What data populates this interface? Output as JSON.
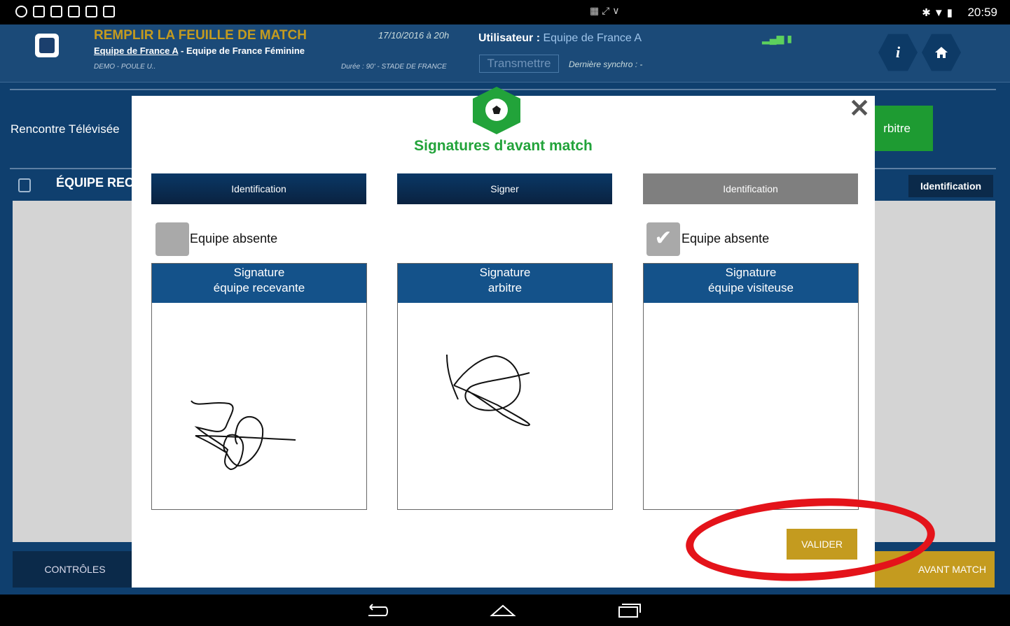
{
  "status_bar": {
    "time": "20:59",
    "left_icons": [
      "eye-icon",
      "messenger-icon",
      "gmail-icon",
      "play-store-icon",
      "shopping-bag-icon",
      "shopping-bag-icon"
    ],
    "right_icons": [
      "bluetooth-icon",
      "wifi-icon",
      "battery-icon"
    ]
  },
  "header": {
    "title": "REMPLIR LA FEUILLE DE MATCH",
    "home_team": "Equipe de France A",
    "teams_separator": " - ",
    "away_team": "Equipe de France Féminine",
    "competition": "DEMO - POULE U..",
    "date": "17/10/2016 à 20h",
    "duration": "Durée : 90' - STADE DE FRANCE",
    "user_label": "Utilisateur :",
    "user_value": "Equipe de France A",
    "transmit_label": "Transmettre",
    "sync_label": "Dernière synchro : -",
    "info_icon": "i"
  },
  "background": {
    "rencontre_label": "Rencontre Télévisée",
    "arbitre_button": "rbitre",
    "equipe_label": "ÉQUIPE REC",
    "identification_button": "Identification",
    "controles_button": "CONTRÔLES",
    "avant_match_button": "AVANT MATCH"
  },
  "modal": {
    "title": "Signatures d'avant match",
    "close": "✕",
    "columns": [
      {
        "button": "Identification",
        "absent_label": "Equipe absente",
        "absent_checked": false,
        "sig_line1": "Signature",
        "sig_line2": "équipe recevante"
      },
      {
        "button": "Signer",
        "sig_line1": "Signature",
        "sig_line2": "arbitre"
      },
      {
        "button": "Identification",
        "absent_label": "Equipe absente",
        "absent_checked": true,
        "sig_line1": "Signature",
        "sig_line2": "équipe visiteuse"
      }
    ],
    "valider": "VALIDER"
  },
  "colors": {
    "accent_gold": "#c49b1f",
    "green": "#22a33a",
    "navy": "#0f3f6e",
    "highlight_red": "#e4131a"
  }
}
